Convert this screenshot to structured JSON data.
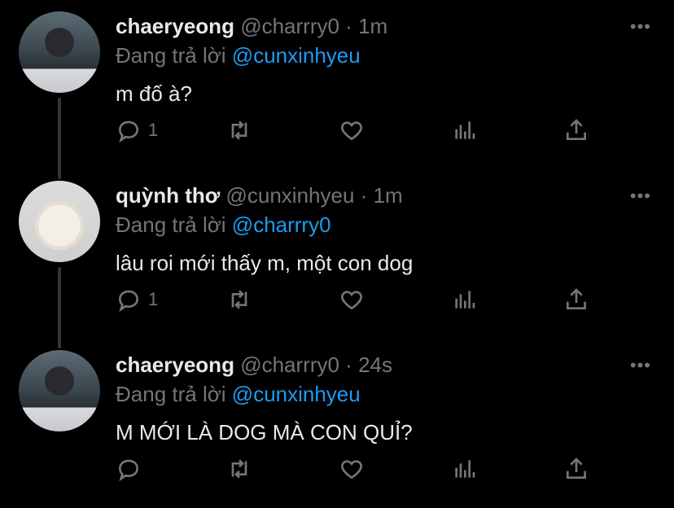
{
  "tweets": [
    {
      "display_name": "chaeryeong",
      "handle": "@charrry0",
      "time": "1m",
      "reply_prefix": "Đang trả lời",
      "reply_to": "@cunxinhyeu",
      "text": "m đố à?",
      "reply_count": "1"
    },
    {
      "display_name": "quỳnh thơ",
      "handle": "@cunxinhyeu",
      "time": "1m",
      "reply_prefix": "Đang trả lời",
      "reply_to": "@charrry0",
      "text": "lâu roi mới thấy m, một con dog",
      "reply_count": "1"
    },
    {
      "display_name": "chaeryeong",
      "handle": "@charrry0",
      "time": "24s",
      "reply_prefix": "Đang trả lời",
      "reply_to": "@cunxinhyeu",
      "text": "M MỚI LÀ DOG MÀ CON QUỈ?",
      "reply_count": ""
    }
  ],
  "separator": "·",
  "more_label": "•••",
  "colors": {
    "background": "#000000",
    "text": "#e7e9ea",
    "muted": "#71767b",
    "link": "#1d9bf0"
  },
  "icons": [
    "reply-icon",
    "retweet-icon",
    "like-icon",
    "views-icon",
    "share-icon",
    "more-icon"
  ]
}
